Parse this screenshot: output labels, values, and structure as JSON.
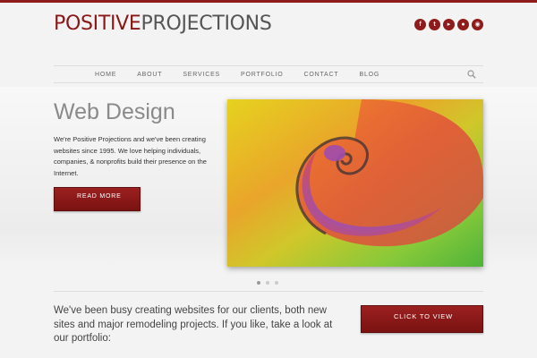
{
  "colors": {
    "accent": "#8a1616",
    "text": "#333333",
    "background": "#f3f3f3"
  },
  "logo": {
    "part1": "POSITIVE",
    "part2": "PROJECTIONS"
  },
  "social": [
    {
      "icon": "facebook-icon",
      "glyph": "f"
    },
    {
      "icon": "twitter-icon",
      "glyph": "t"
    },
    {
      "icon": "youtube-icon",
      "glyph": "▸"
    },
    {
      "icon": "flickr-icon",
      "glyph": "●"
    },
    {
      "icon": "rss-icon",
      "glyph": "◉"
    }
  ],
  "nav": {
    "items": [
      "HOME",
      "ABOUT",
      "SERVICES",
      "PORTFOLIO",
      "CONTACT",
      "BLOG"
    ],
    "search_icon": "search-icon"
  },
  "hero": {
    "title": "Web Design",
    "text": "We're Positive Projections and we've been creating websites since 1995. We love helping individuals, companies, & nonprofits build their presence on the Internet.",
    "button": "READ MORE"
  },
  "slider": {
    "dots": 3,
    "active": 0
  },
  "cta": {
    "text": "We've been busy creating websites for our clients, both new sites and major remodeling projects. If you like, take a look at our portfolio:",
    "button": "CLICK TO VIEW"
  }
}
